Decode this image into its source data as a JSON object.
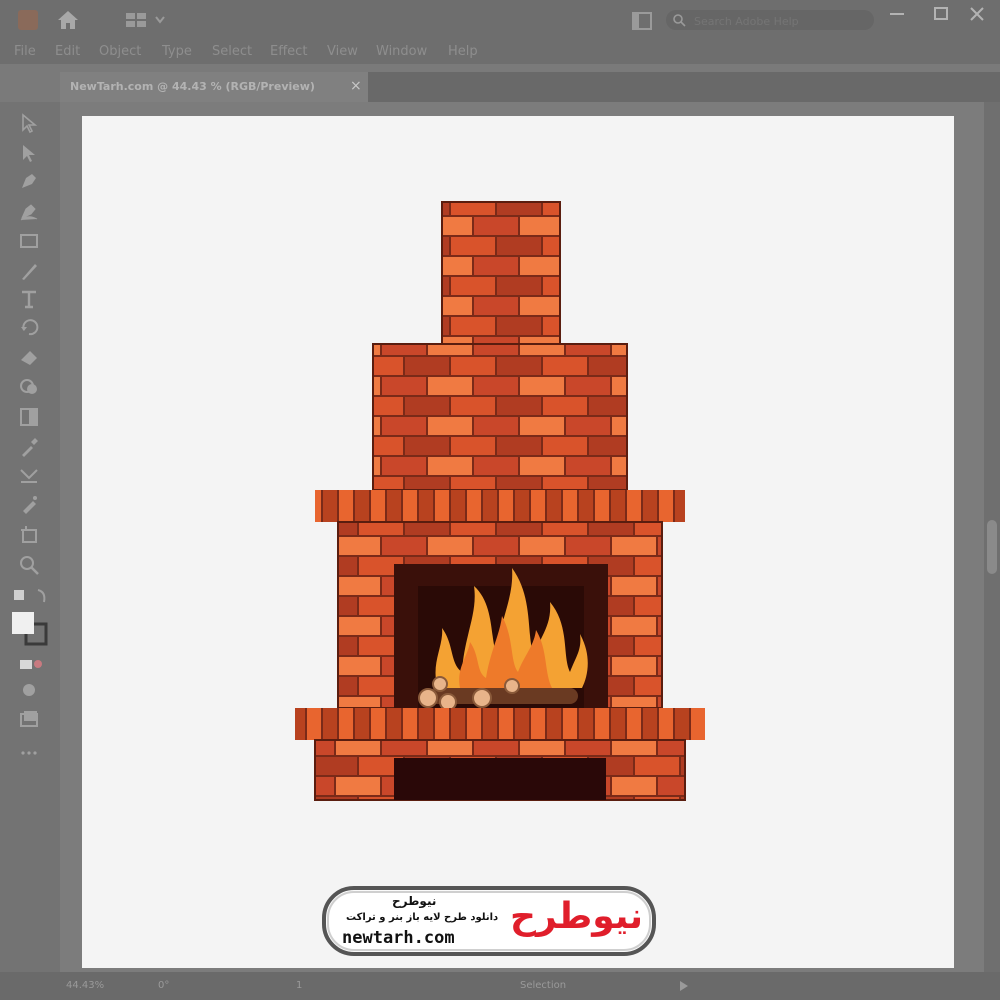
{
  "window": {
    "title_tab": "NewTarh.com @ 44.43 % (RGB/Preview)",
    "tab_close": "×",
    "search_placeholder": "Search Adobe Help"
  },
  "menu": [
    "File",
    "Edit",
    "Object",
    "Type",
    "Select",
    "Effect",
    "View",
    "Window",
    "Help"
  ],
  "tools": [
    "selection-tool-icon",
    "direct-selection-tool-icon",
    "pen-tool-icon",
    "curvature-tool-icon",
    "rectangle-tool-icon",
    "paintbrush-tool-icon",
    "type-tool-icon",
    "rotate-tool-icon",
    "eraser-tool-icon",
    "shape-builder-tool-icon",
    "gradient-tool-icon",
    "eyedropper-tool-icon",
    "blend-tool-icon",
    "symbol-sprayer-tool-icon",
    "artboard-tool-icon",
    "zoom-tool-icon"
  ],
  "status": {
    "zoom": "44.43%",
    "rotation": "0°",
    "artboard_number": "1",
    "tool_name": "Selection"
  },
  "logo": {
    "brand_fa": "نیوطرح",
    "tagline_fa": "دانلود طرح لایه باز بنر و تراکت",
    "url": "newtarh.com",
    "logo_mark_fa": "نیوطرح"
  },
  "colors": {
    "ui_dark": "#6e6e6e",
    "artboard": "#f4f4f4",
    "brick_dark": "#b03c22",
    "brick_mid": "#d9532b",
    "brick_light": "#f07a42",
    "mortar": "#7a2a18",
    "firebox": "#3a100a",
    "flame_outer": "#f4a233",
    "flame_inner": "#ee7a2a",
    "logo_red": "#e01e2b"
  }
}
